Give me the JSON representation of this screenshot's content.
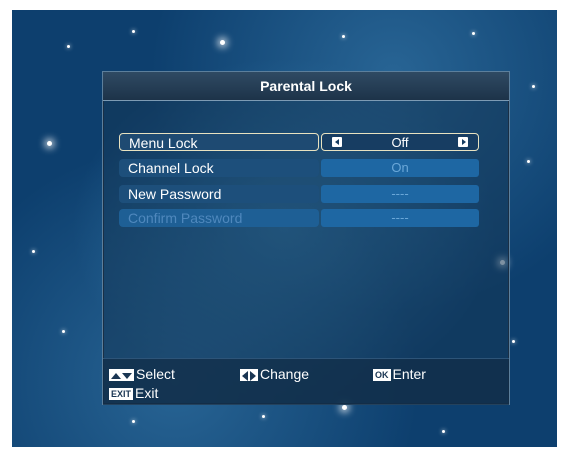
{
  "dialog": {
    "title": "Parental Lock"
  },
  "rows": [
    {
      "label": "Menu Lock",
      "value": "Off",
      "selected": true
    },
    {
      "label": "Channel Lock",
      "value": "On"
    },
    {
      "label": "New Password",
      "value": "----"
    },
    {
      "label": "Confirm Password",
      "value": "----",
      "disabled": true
    }
  ],
  "help": {
    "select": {
      "key": "up-down-icon",
      "label": "Select"
    },
    "change": {
      "key": "left-right-icon",
      "label": "Change"
    },
    "enter": {
      "key": "OK",
      "label": "Enter"
    },
    "exit": {
      "key": "EXIT",
      "label": "Exit"
    }
  },
  "colors": {
    "accent": "#e8e2c0",
    "row_bg": "#1d4f7b",
    "value_bg": "#1e67a3"
  }
}
